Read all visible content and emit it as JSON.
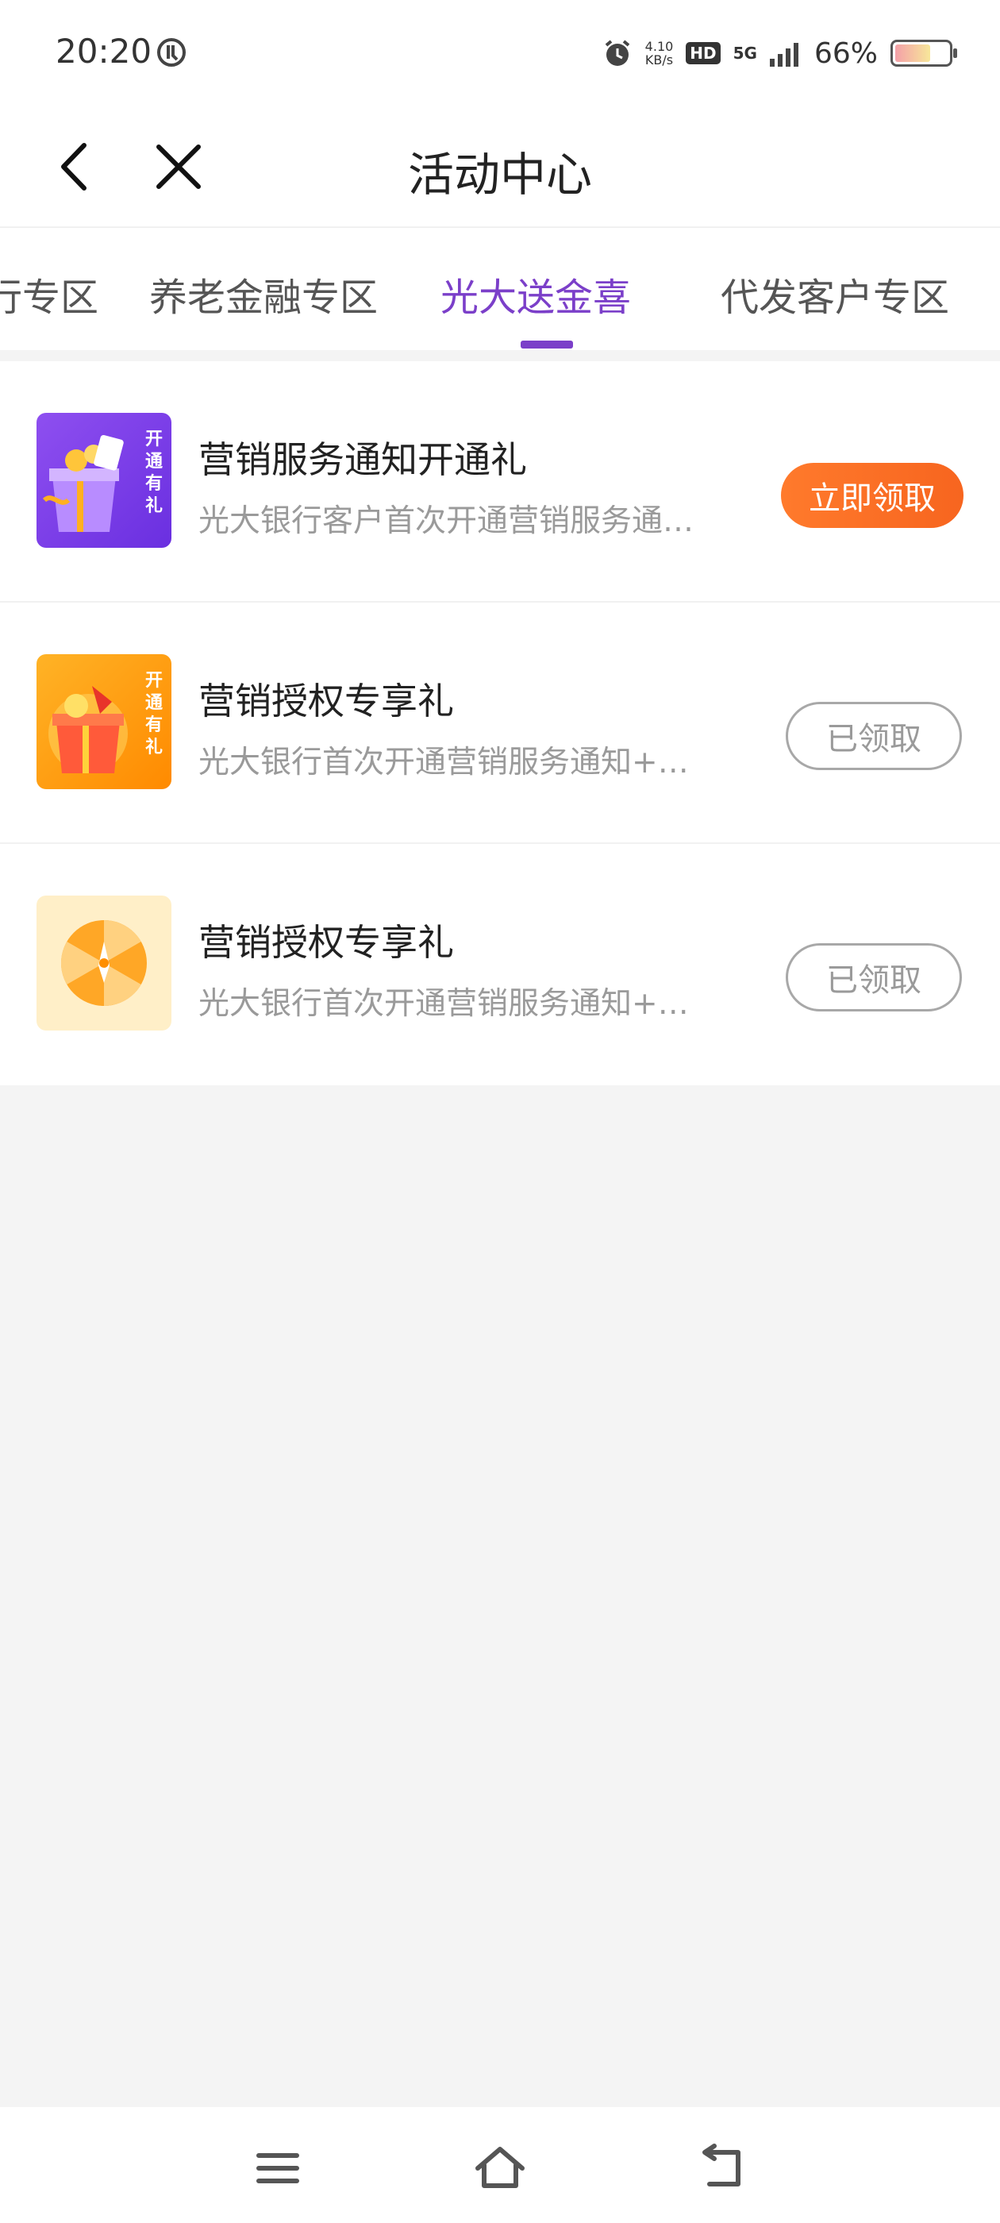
{
  "status_bar": {
    "time": "20:20",
    "net_speed_value": "4.10",
    "net_speed_unit": "KB/s",
    "hd_label": "HD",
    "network_label": "5G",
    "battery_percent": "66%",
    "battery_level": 0.66
  },
  "nav": {
    "title": "活动中心"
  },
  "tabs": [
    {
      "label": "行专区"
    },
    {
      "label": "养老金融专区"
    },
    {
      "label": "光大送金喜",
      "active": true
    },
    {
      "label": "代发客户专区"
    }
  ],
  "items": [
    {
      "title": "营销服务通知开通礼",
      "desc": "光大银行客户首次开通营销服务通知享受惊喜好礼",
      "button": "立即领取",
      "thumb_text": "开通有礼",
      "claimed": false
    },
    {
      "title": "营销授权专享礼",
      "desc": "光大银行首次开通营销服务通知+营销授权专享好礼",
      "button": "已领取",
      "thumb_text": "开通有礼",
      "claimed": true
    },
    {
      "title": "营销授权专享礼",
      "desc": "光大银行首次开通营销服务通知+营销授权专享好礼",
      "button": "已领取",
      "claimed": true
    }
  ],
  "colors": {
    "accent": "#7b3fc9",
    "claim_button": "#f7651f"
  }
}
